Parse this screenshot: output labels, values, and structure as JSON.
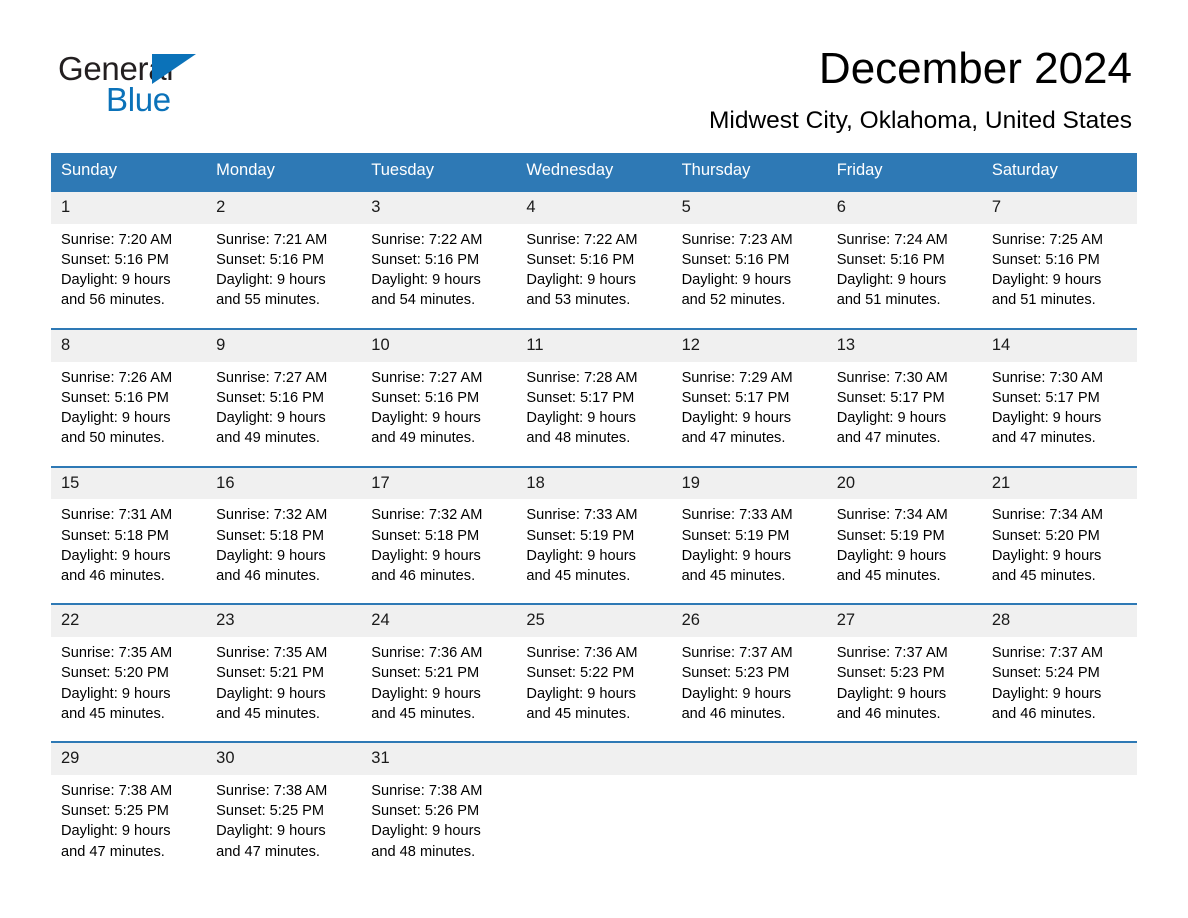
{
  "logo": {
    "word_one": "General",
    "word_two": "Blue",
    "triangle_icon": "blue-triangle-icon"
  },
  "header": {
    "month_title": "December 2024",
    "location": "Midwest City, Oklahoma, United States"
  },
  "colors": {
    "header_blue": "#2e79b5",
    "logo_blue": "#0b72b9",
    "daynum_band": "#f0f0f0",
    "text": "#000000"
  },
  "weekday_headers": [
    "Sunday",
    "Monday",
    "Tuesday",
    "Wednesday",
    "Thursday",
    "Friday",
    "Saturday"
  ],
  "weeks": [
    {
      "daynums": [
        "1",
        "2",
        "3",
        "4",
        "5",
        "6",
        "7"
      ],
      "cells": [
        {
          "sunrise": "Sunrise: 7:20 AM",
          "sunset": "Sunset: 5:16 PM",
          "daylight1": "Daylight: 9 hours",
          "daylight2": "and 56 minutes."
        },
        {
          "sunrise": "Sunrise: 7:21 AM",
          "sunset": "Sunset: 5:16 PM",
          "daylight1": "Daylight: 9 hours",
          "daylight2": "and 55 minutes."
        },
        {
          "sunrise": "Sunrise: 7:22 AM",
          "sunset": "Sunset: 5:16 PM",
          "daylight1": "Daylight: 9 hours",
          "daylight2": "and 54 minutes."
        },
        {
          "sunrise": "Sunrise: 7:22 AM",
          "sunset": "Sunset: 5:16 PM",
          "daylight1": "Daylight: 9 hours",
          "daylight2": "and 53 minutes."
        },
        {
          "sunrise": "Sunrise: 7:23 AM",
          "sunset": "Sunset: 5:16 PM",
          "daylight1": "Daylight: 9 hours",
          "daylight2": "and 52 minutes."
        },
        {
          "sunrise": "Sunrise: 7:24 AM",
          "sunset": "Sunset: 5:16 PM",
          "daylight1": "Daylight: 9 hours",
          "daylight2": "and 51 minutes."
        },
        {
          "sunrise": "Sunrise: 7:25 AM",
          "sunset": "Sunset: 5:16 PM",
          "daylight1": "Daylight: 9 hours",
          "daylight2": "and 51 minutes."
        }
      ]
    },
    {
      "daynums": [
        "8",
        "9",
        "10",
        "11",
        "12",
        "13",
        "14"
      ],
      "cells": [
        {
          "sunrise": "Sunrise: 7:26 AM",
          "sunset": "Sunset: 5:16 PM",
          "daylight1": "Daylight: 9 hours",
          "daylight2": "and 50 minutes."
        },
        {
          "sunrise": "Sunrise: 7:27 AM",
          "sunset": "Sunset: 5:16 PM",
          "daylight1": "Daylight: 9 hours",
          "daylight2": "and 49 minutes."
        },
        {
          "sunrise": "Sunrise: 7:27 AM",
          "sunset": "Sunset: 5:16 PM",
          "daylight1": "Daylight: 9 hours",
          "daylight2": "and 49 minutes."
        },
        {
          "sunrise": "Sunrise: 7:28 AM",
          "sunset": "Sunset: 5:17 PM",
          "daylight1": "Daylight: 9 hours",
          "daylight2": "and 48 minutes."
        },
        {
          "sunrise": "Sunrise: 7:29 AM",
          "sunset": "Sunset: 5:17 PM",
          "daylight1": "Daylight: 9 hours",
          "daylight2": "and 47 minutes."
        },
        {
          "sunrise": "Sunrise: 7:30 AM",
          "sunset": "Sunset: 5:17 PM",
          "daylight1": "Daylight: 9 hours",
          "daylight2": "and 47 minutes."
        },
        {
          "sunrise": "Sunrise: 7:30 AM",
          "sunset": "Sunset: 5:17 PM",
          "daylight1": "Daylight: 9 hours",
          "daylight2": "and 47 minutes."
        }
      ]
    },
    {
      "daynums": [
        "15",
        "16",
        "17",
        "18",
        "19",
        "20",
        "21"
      ],
      "cells": [
        {
          "sunrise": "Sunrise: 7:31 AM",
          "sunset": "Sunset: 5:18 PM",
          "daylight1": "Daylight: 9 hours",
          "daylight2": "and 46 minutes."
        },
        {
          "sunrise": "Sunrise: 7:32 AM",
          "sunset": "Sunset: 5:18 PM",
          "daylight1": "Daylight: 9 hours",
          "daylight2": "and 46 minutes."
        },
        {
          "sunrise": "Sunrise: 7:32 AM",
          "sunset": "Sunset: 5:18 PM",
          "daylight1": "Daylight: 9 hours",
          "daylight2": "and 46 minutes."
        },
        {
          "sunrise": "Sunrise: 7:33 AM",
          "sunset": "Sunset: 5:19 PM",
          "daylight1": "Daylight: 9 hours",
          "daylight2": "and 45 minutes."
        },
        {
          "sunrise": "Sunrise: 7:33 AM",
          "sunset": "Sunset: 5:19 PM",
          "daylight1": "Daylight: 9 hours",
          "daylight2": "and 45 minutes."
        },
        {
          "sunrise": "Sunrise: 7:34 AM",
          "sunset": "Sunset: 5:19 PM",
          "daylight1": "Daylight: 9 hours",
          "daylight2": "and 45 minutes."
        },
        {
          "sunrise": "Sunrise: 7:34 AM",
          "sunset": "Sunset: 5:20 PM",
          "daylight1": "Daylight: 9 hours",
          "daylight2": "and 45 minutes."
        }
      ]
    },
    {
      "daynums": [
        "22",
        "23",
        "24",
        "25",
        "26",
        "27",
        "28"
      ],
      "cells": [
        {
          "sunrise": "Sunrise: 7:35 AM",
          "sunset": "Sunset: 5:20 PM",
          "daylight1": "Daylight: 9 hours",
          "daylight2": "and 45 minutes."
        },
        {
          "sunrise": "Sunrise: 7:35 AM",
          "sunset": "Sunset: 5:21 PM",
          "daylight1": "Daylight: 9 hours",
          "daylight2": "and 45 minutes."
        },
        {
          "sunrise": "Sunrise: 7:36 AM",
          "sunset": "Sunset: 5:21 PM",
          "daylight1": "Daylight: 9 hours",
          "daylight2": "and 45 minutes."
        },
        {
          "sunrise": "Sunrise: 7:36 AM",
          "sunset": "Sunset: 5:22 PM",
          "daylight1": "Daylight: 9 hours",
          "daylight2": "and 45 minutes."
        },
        {
          "sunrise": "Sunrise: 7:37 AM",
          "sunset": "Sunset: 5:23 PM",
          "daylight1": "Daylight: 9 hours",
          "daylight2": "and 46 minutes."
        },
        {
          "sunrise": "Sunrise: 7:37 AM",
          "sunset": "Sunset: 5:23 PM",
          "daylight1": "Daylight: 9 hours",
          "daylight2": "and 46 minutes."
        },
        {
          "sunrise": "Sunrise: 7:37 AM",
          "sunset": "Sunset: 5:24 PM",
          "daylight1": "Daylight: 9 hours",
          "daylight2": "and 46 minutes."
        }
      ]
    },
    {
      "daynums": [
        "29",
        "30",
        "31",
        "",
        "",
        "",
        ""
      ],
      "cells": [
        {
          "sunrise": "Sunrise: 7:38 AM",
          "sunset": "Sunset: 5:25 PM",
          "daylight1": "Daylight: 9 hours",
          "daylight2": "and 47 minutes."
        },
        {
          "sunrise": "Sunrise: 7:38 AM",
          "sunset": "Sunset: 5:25 PM",
          "daylight1": "Daylight: 9 hours",
          "daylight2": "and 47 minutes."
        },
        {
          "sunrise": "Sunrise: 7:38 AM",
          "sunset": "Sunset: 5:26 PM",
          "daylight1": "Daylight: 9 hours",
          "daylight2": "and 48 minutes."
        },
        {
          "sunrise": "",
          "sunset": "",
          "daylight1": "",
          "daylight2": ""
        },
        {
          "sunrise": "",
          "sunset": "",
          "daylight1": "",
          "daylight2": ""
        },
        {
          "sunrise": "",
          "sunset": "",
          "daylight1": "",
          "daylight2": ""
        },
        {
          "sunrise": "",
          "sunset": "",
          "daylight1": "",
          "daylight2": ""
        }
      ]
    }
  ]
}
